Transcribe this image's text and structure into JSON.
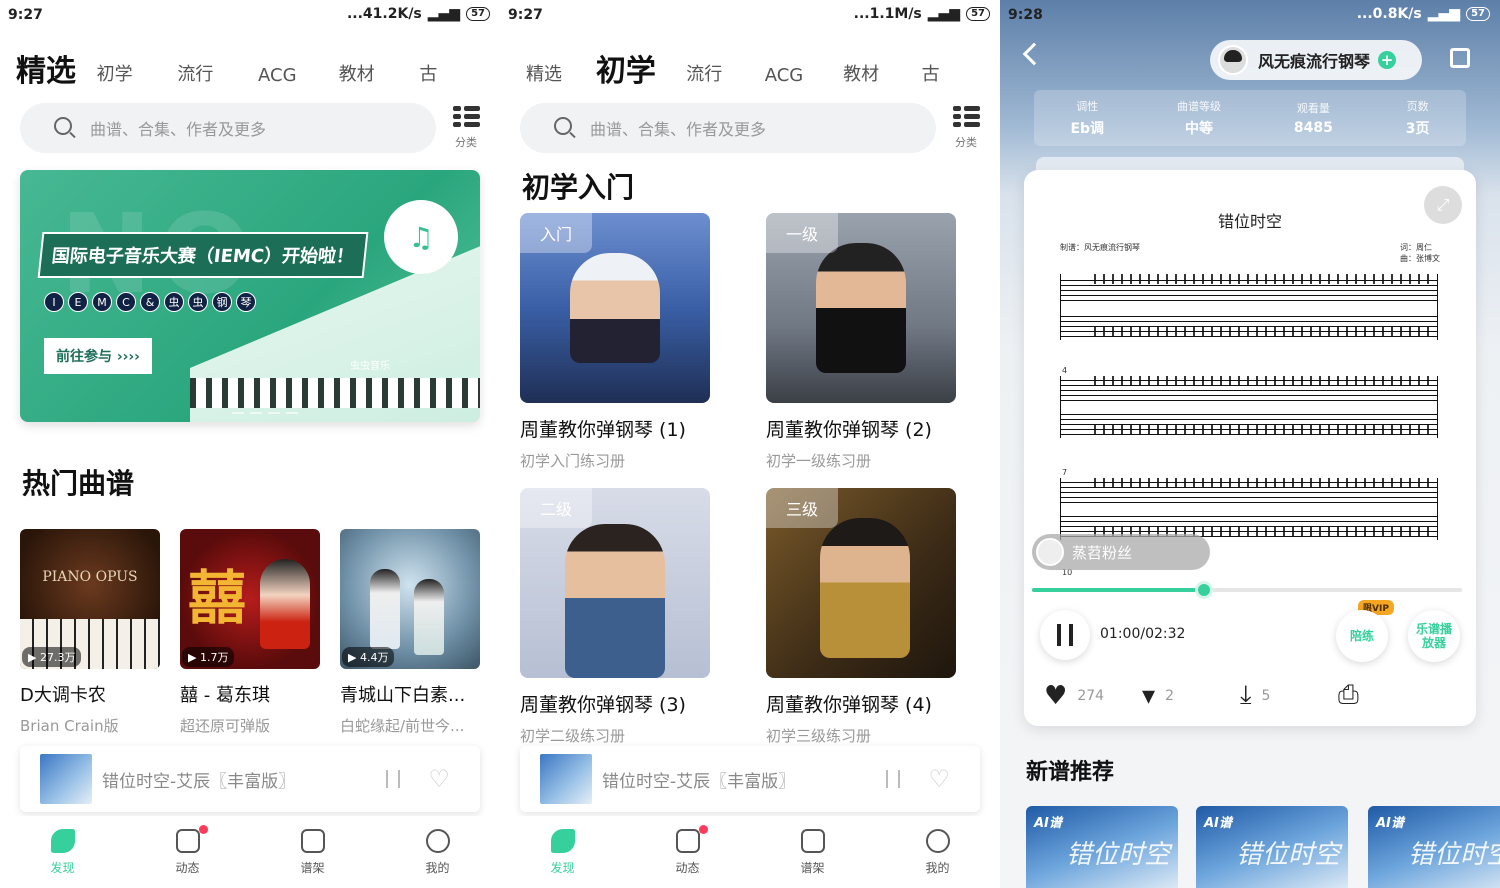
{
  "screens": [
    {
      "status": {
        "time": "9:27",
        "speed": "...41.2K/s",
        "battery": "57"
      },
      "tabs": [
        "精选",
        "初学",
        "流行",
        "ACG",
        "教材",
        "古"
      ],
      "active_tab": 0,
      "search_placeholder": "曲谱、合集、作者及更多",
      "category_label": "分类",
      "banner": {
        "title": "国际电子音乐大赛（IEMC）开始啦！",
        "letters": [
          "I",
          "E",
          "M",
          "C",
          "&",
          "虫",
          "虫",
          "钢",
          "琴"
        ],
        "cta": "前往参与 ››››",
        "brand": "虫虫音乐"
      },
      "hot_title": "热门曲谱",
      "hot_items": [
        {
          "plays": "27.3万",
          "name": "D大调卡农",
          "sub": "Brian Crain版",
          "cover_text": "PIANO OPUS"
        },
        {
          "plays": "1.7万",
          "name": "囍 - 葛东琪",
          "sub": "超还原可弹版",
          "cover_text": "囍"
        },
        {
          "plays": "4.4万",
          "name": "青城山下白素...",
          "sub": "白蛇缘起/前世今..."
        }
      ],
      "player_title": "错位时空-艾辰〖丰富版〗",
      "nav": [
        {
          "label": "发现",
          "active": true
        },
        {
          "label": "动态",
          "badge": true
        },
        {
          "label": "谱架"
        },
        {
          "label": "我的"
        }
      ]
    },
    {
      "status": {
        "time": "9:27",
        "speed": "...1.1M/s",
        "battery": "57"
      },
      "tabs": [
        "精选",
        "初学",
        "流行",
        "ACG",
        "教材",
        "古"
      ],
      "active_tab": 1,
      "search_placeholder": "曲谱、合集、作者及更多",
      "category_label": "分类",
      "section_title": "初学入门",
      "courses": [
        {
          "tag": "入门",
          "name": "周董教你弹钢琴 (1)",
          "sub": "初学入门练习册"
        },
        {
          "tag": "一级",
          "name": "周董教你弹钢琴 (2)",
          "sub": "初学一级练习册"
        },
        {
          "tag": "二级",
          "name": "周董教你弹钢琴 (3)",
          "sub": "初学二级练习册"
        },
        {
          "tag": "三级",
          "name": "周董教你弹钢琴 (4)",
          "sub": "初学三级练习册"
        }
      ],
      "player_title": "错位时空-艾辰〖丰富版〗",
      "nav": [
        {
          "label": "发现",
          "active": true
        },
        {
          "label": "动态",
          "badge": true
        },
        {
          "label": "谱架"
        },
        {
          "label": "我的"
        }
      ]
    },
    {
      "status": {
        "time": "9:28",
        "speed": "...0.8K/s",
        "battery": "57"
      },
      "uploader": "风无痕流行钢琴",
      "stats": [
        {
          "k": "调性",
          "v": "Eb调"
        },
        {
          "k": "曲谱等级",
          "v": "中等"
        },
        {
          "k": "观看量",
          "v": "8485"
        },
        {
          "k": "页数",
          "v": "3页"
        }
      ],
      "sheet": {
        "title": "错位时空",
        "maker": "制谱：风无痕流行钢琴",
        "lyric": "词：周仁",
        "composer": "曲：张博文",
        "measures": [
          "4",
          "7",
          "10"
        ]
      },
      "fan_label": "蒸苕粉丝",
      "progress": 0.4,
      "time_text": "01:00/02:32",
      "vip_badge": "限VIP",
      "accompany": "陪练",
      "player_mode": "乐谱播放器",
      "actions": {
        "likes": "274",
        "comments": "2",
        "downloads": "5"
      },
      "new_title": "新谱推荐",
      "new_badge": "AI谱",
      "new_cover_text": "错位时空"
    }
  ]
}
